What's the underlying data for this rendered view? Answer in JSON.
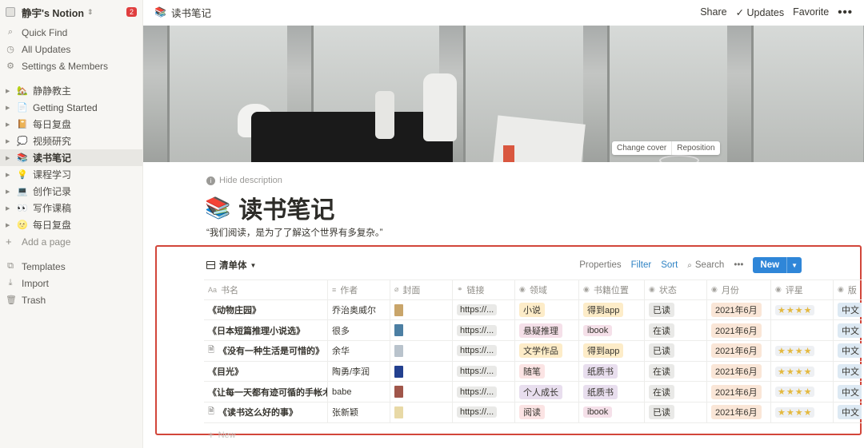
{
  "sidebar": {
    "workspace": "静宇's Notion",
    "badge": "2",
    "nav": [
      {
        "label": "Quick Find",
        "icon": "search-icon"
      },
      {
        "label": "All Updates",
        "icon": "clock-icon"
      },
      {
        "label": "Settings & Members",
        "icon": "gear-icon"
      }
    ],
    "pages": [
      {
        "label": "静静教主",
        "emoji": "🏡"
      },
      {
        "label": "Getting Started",
        "emoji": "📄"
      },
      {
        "label": "每日复盘",
        "emoji": "📔"
      },
      {
        "label": "视频研究",
        "emoji": "💭"
      },
      {
        "label": "读书笔记",
        "emoji": "📚",
        "active": true
      },
      {
        "label": "课程学习",
        "emoji": "💡"
      },
      {
        "label": "创作记录",
        "emoji": "💻"
      },
      {
        "label": "写作课稿",
        "emoji": "👀"
      },
      {
        "label": "每日复盘",
        "emoji": "🌝"
      }
    ],
    "add_page": "Add a page",
    "bottom": [
      {
        "label": "Templates",
        "icon": "templates-icon"
      },
      {
        "label": "Import",
        "icon": "import-icon"
      },
      {
        "label": "Trash",
        "icon": "trash-icon"
      }
    ]
  },
  "topbar": {
    "breadcrumb_emoji": "📚",
    "breadcrumb": "读书笔记",
    "share": "Share",
    "updates": "Updates",
    "favorite": "Favorite",
    "more": "•••"
  },
  "cover": {
    "change_cover": "Change cover",
    "reposition": "Reposition"
  },
  "page": {
    "hide_description": "Hide description",
    "title_emoji": "📚",
    "title": "读书笔记",
    "description": "“我们阅读，是为了了解这个世界有多复杂。”"
  },
  "database": {
    "view_name": "清单体",
    "properties": "Properties",
    "filter": "Filter",
    "sort": "Sort",
    "search": "Search",
    "more": "•••",
    "new": "New",
    "new_row": "New",
    "columns": [
      {
        "label": "书名",
        "icon": "Aa"
      },
      {
        "label": "作者",
        "icon": "≡"
      },
      {
        "label": "封面",
        "icon": "⌀"
      },
      {
        "label": "链接",
        "icon": "⚭"
      },
      {
        "label": "领域",
        "icon": "◉"
      },
      {
        "label": "书籍位置",
        "icon": "◉"
      },
      {
        "label": "状态",
        "icon": "◉"
      },
      {
        "label": "月份",
        "icon": "◉"
      },
      {
        "label": "评星",
        "icon": "◉"
      },
      {
        "label": "版",
        "icon": "◉"
      }
    ],
    "rows": [
      {
        "title": "《动物庄园》",
        "doc": false,
        "author": "乔治奥威尔",
        "cover_color": "#c9a56a",
        "link": "https://...",
        "domain": "小说",
        "domain_color": "#fdecc8",
        "location": "得到app",
        "location_color": "#fdecc8",
        "status": "已读",
        "month": "2021年6月",
        "stars": "★★★★",
        "version": "中文"
      },
      {
        "title": "《日本短篇推理小说选》",
        "doc": false,
        "author": "很多",
        "cover_color": "#4c7fa3",
        "link": "https://...",
        "domain": "悬疑推理",
        "domain_color": "#f5e0e9",
        "location": "ibook",
        "location_color": "#f5e0e9",
        "status": "在读",
        "month": "2021年6月",
        "stars": "",
        "version": "中文"
      },
      {
        "title": "《没有一种生活是可惜的》",
        "doc": true,
        "author": "余华",
        "cover_color": "#b9c3cc",
        "link": "https://...",
        "domain": "文学作品",
        "domain_color": "#fdecc8",
        "location": "得到app",
        "location_color": "#fdecc8",
        "status": "已读",
        "month": "2021年6月",
        "stars": "★★★★",
        "version": "中文"
      },
      {
        "title": "《目光》",
        "doc": false,
        "author": "陶勇/李润",
        "cover_color": "#23408f",
        "link": "https://...",
        "domain": "随笔",
        "domain_color": "#fbe4e4",
        "location": "纸质书",
        "location_color": "#e8deee",
        "status": "在读",
        "month": "2021年6月",
        "stars": "★★★★",
        "version": "中文"
      },
      {
        "title": "《让每一天都有迹可循的手帐术》",
        "doc": false,
        "author": "babe",
        "cover_color": "#a0564a",
        "link": "https://...",
        "domain": "个人成长",
        "domain_color": "#e8deee",
        "location": "纸质书",
        "location_color": "#e8deee",
        "status": "在读",
        "month": "2021年6月",
        "stars": "★★★★",
        "version": "中文"
      },
      {
        "title": "《读书这么好的事》",
        "doc": true,
        "author": "张新颖",
        "cover_color": "#e8d9a6",
        "link": "https://...",
        "domain": "阅读",
        "domain_color": "#fbe4e4",
        "location": "ibook",
        "location_color": "#f5e0e9",
        "status": "已读",
        "month": "2021年6月",
        "stars": "★★★★",
        "version": "中文"
      }
    ]
  }
}
